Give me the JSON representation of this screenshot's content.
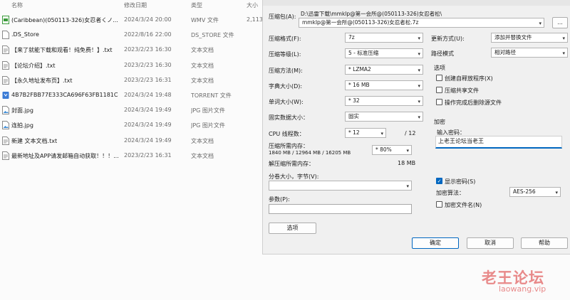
{
  "explorer": {
    "columns": {
      "name": "名称",
      "date": "修改日期",
      "type": "类型",
      "size": "大小"
    },
    "files": [
      {
        "name": "(Caribbean)(050113-326)女忍者くノ...",
        "date": "2024/3/24 20:00",
        "type": "WMV 文件",
        "size": "2,113",
        "icon": "video-file-icon"
      },
      {
        "name": ".DS_Store",
        "date": "2022/8/16 22:00",
        "type": "DS_STORE 文件",
        "size": "",
        "icon": "blank-file-icon"
      },
      {
        "name": "【来了就能下载和观看！纯免费！】.txt",
        "date": "2023/2/23 16:30",
        "type": "文本文档",
        "size": "",
        "icon": "text-file-icon"
      },
      {
        "name": "【论坛介绍】.txt",
        "date": "2023/2/23 16:30",
        "type": "文本文档",
        "size": "",
        "icon": "text-file-icon"
      },
      {
        "name": "【永久地址发布页】.txt",
        "date": "2023/2/23 16:31",
        "type": "文本文档",
        "size": "",
        "icon": "text-file-icon"
      },
      {
        "name": "4B7B2FBB77E333CA696F63FB1181C4...",
        "date": "2024/3/24 19:48",
        "type": "TORRENT 文件",
        "size": "",
        "icon": "torrent-file-icon"
      },
      {
        "name": "封面.jpg",
        "date": "2024/3/24 19:49",
        "type": "JPG 图片文件",
        "size": "",
        "icon": "image-file-icon"
      },
      {
        "name": "连拍.jpg",
        "date": "2024/3/24 19:49",
        "type": "JPG 图片文件",
        "size": "",
        "icon": "image-file-icon"
      },
      {
        "name": "新建 文本文档.txt",
        "date": "2024/3/24 19:49",
        "type": "文本文档",
        "size": "",
        "icon": "text-file-icon"
      },
      {
        "name": "最新地址及APP请发邮箱自动获取！！！...",
        "date": "2023/2/23 16:31",
        "type": "文本文档",
        "size": "",
        "icon": "text-file-icon"
      }
    ]
  },
  "dialog": {
    "archive_label": "压缩包(A):",
    "archive_path": "D:\\迅雷下载\\mmklp@第一会所@(050113-326)女忍者松\\",
    "archive_name": "mmklp@第一会所@(050113-326)女忍者松.7z",
    "browse_label": "...",
    "format_label": "压缩格式(F):",
    "format_value": "7z",
    "level_label": "压缩等级(L):",
    "level_value": "5 - 标准压缩",
    "method_label": "压缩方法(M):",
    "method_value": "* LZMA2",
    "dict_label": "字典大小(D):",
    "dict_value": "* 16 MB",
    "word_label": "单词大小(W):",
    "word_value": "* 32",
    "solid_label": "固实数据大小：",
    "solid_value": "固实",
    "threads_label": "CPU 线程数：",
    "threads_value": "* 12",
    "threads_total": "/ 12",
    "mem_label": "压缩所需内存：",
    "mem_detail": "1840 MB / 12964 MB / 16205 MB",
    "mem_percent": "* 80%",
    "decomp_label": "解压缩所需内存：",
    "decomp_value": "18 MB",
    "split_label": "分卷大小，字节(V):",
    "params_label": "参数(P):",
    "options_button": "选项",
    "update_label": "更新方式(U):",
    "update_value": "添加并替换文件",
    "path_label": "路径模式",
    "path_value": "相对路径",
    "options_group": "选项",
    "opt_sfx": "创建自释放程序(X)",
    "opt_shared": "压缩共享文件",
    "opt_delete": "操作完成后删除源文件",
    "encrypt_group": "加密",
    "pwd_label": "输入密码：",
    "pwd_value": "上老王论坛当老王",
    "show_pwd": "显示密码(S)",
    "algo_label": "加密算法：",
    "algo_value": "AES-256",
    "encrypt_names": "加密文件名(N)",
    "ok": "确定",
    "cancel": "取消",
    "help": "帮助"
  },
  "watermark": {
    "line1": "老王论坛",
    "line2": "laowang.vip"
  }
}
